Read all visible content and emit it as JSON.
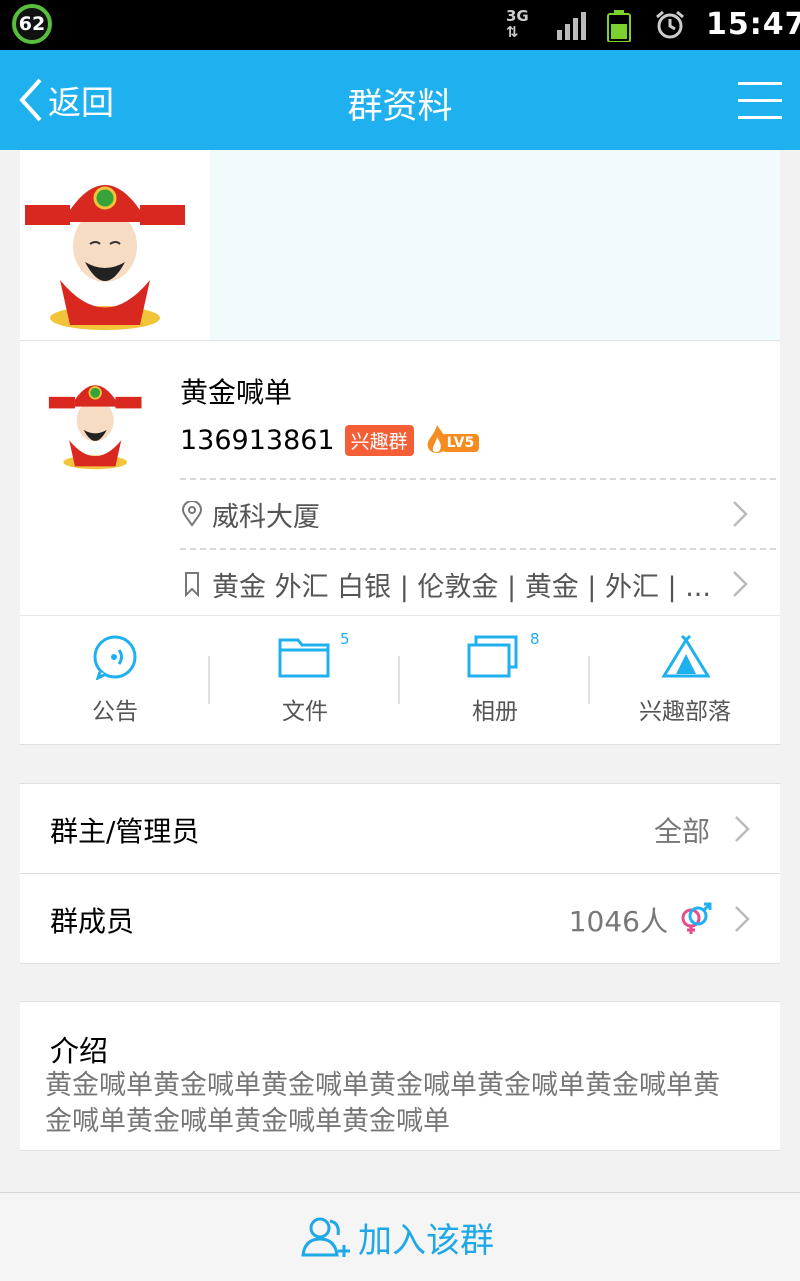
{
  "status_bar": {
    "battery_level": "62",
    "network": "3G",
    "time": "15:47",
    "icons": [
      "battery-percent-icon",
      "network-3g-icon",
      "signal-icon",
      "battery-icon",
      "alarm-icon"
    ]
  },
  "nav": {
    "back_label": "返回",
    "title": "群资料",
    "menu_icon": "menu-icon"
  },
  "group": {
    "name": "黄金喊单",
    "id": "136913861",
    "type_badge": "兴趣群",
    "level": "LV5",
    "location": "威科大厦",
    "tags": "黄金  外汇  白银 | 伦敦金 | 黄金 | 外汇 | ..."
  },
  "tools": [
    {
      "label": "公告",
      "icon": "announcement-icon",
      "count": ""
    },
    {
      "label": "文件",
      "icon": "folder-icon",
      "count": "5"
    },
    {
      "label": "相册",
      "icon": "album-icon",
      "count": "8"
    },
    {
      "label": "兴趣部落",
      "icon": "tribe-tent-icon",
      "count": ""
    }
  ],
  "admins": {
    "label": "群主/管理员",
    "value": "全部"
  },
  "members": {
    "label": "群成员",
    "value": "1046人",
    "icon": "gender-icon"
  },
  "intro": {
    "title": "介绍",
    "body": "黄金喊单黄金喊单黄金喊单黄金喊单黄金喊单黄金喊单黄金喊单黄金喊单黄金喊单黄金喊单"
  },
  "join": {
    "label": "加入该群",
    "icon": "add-group-icon"
  },
  "colors": {
    "accent": "#1fb0ef",
    "badge": "#f45f37",
    "level": "#f68c1f"
  }
}
